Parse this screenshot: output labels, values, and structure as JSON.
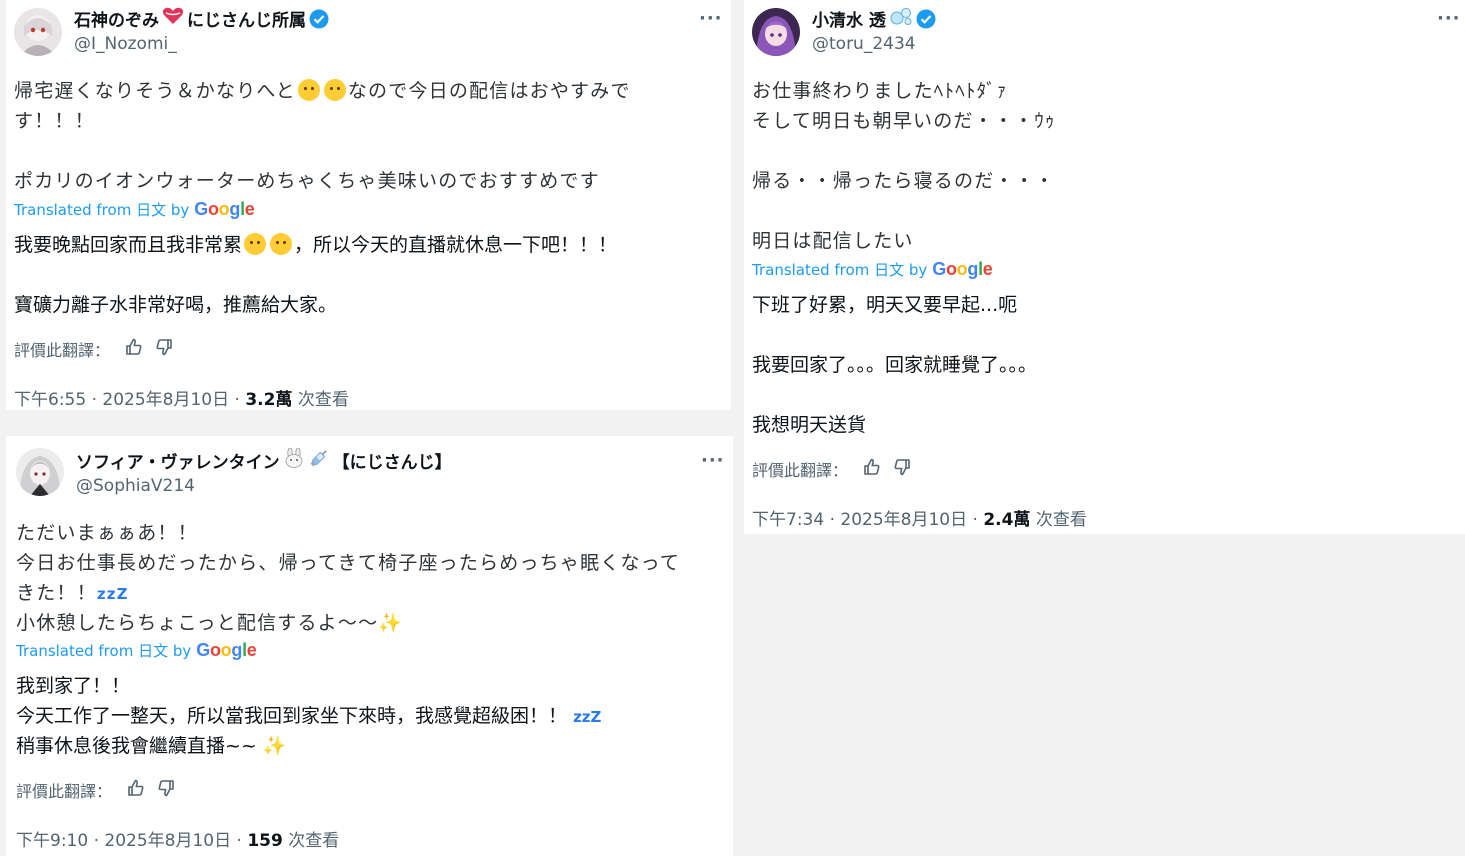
{
  "posts": [
    {
      "id": "nozomi",
      "display_name": "石神のぞみ",
      "display_name_suffix": "にじさんじ所属",
      "handle": "@I_Nozomi_",
      "original_lines": [
        "帰宅遅くなりそう＆かなりへと",
        "なので今日の配信はおやすみで",
        "す！！！",
        "ポカリのイオンウォーターめちゃくちゃ美味いのでおすすめです"
      ],
      "translated_from": "Translated from 日文 by",
      "translated_lines": [
        "我要晚點回家而且我非常累",
        "，所以今天的直播就休息一下吧！！！",
        "寶礦力離子水非常好喝，推薦給大家。"
      ],
      "rate_label": "評價此翻譯：",
      "time": "下午6:55 · 2025年8月10日 · ",
      "views_count": "3.2萬",
      "views_label": " 次查看"
    },
    {
      "id": "toru",
      "display_name": "小清水 透",
      "handle": "@toru_2434",
      "original_lines": [
        "お仕事終わりましたﾍﾄﾍﾄﾀﾞｧ",
        "そして明日も朝早いのだ・・・ｳｩ",
        "帰る・・帰ったら寝るのだ・・・",
        "明日は配信したい"
      ],
      "translated_from": "Translated from 日文 by",
      "translated_lines": [
        "下班了好累，明天又要早起...呃",
        "我要回家了。。。回家就睡覺了。。。",
        "我想明天送貨"
      ],
      "rate_label": "評價此翻譯：",
      "time": "下午7:34 · 2025年8月10日 · ",
      "views_count": "2.4萬",
      "views_label": " 次查看"
    },
    {
      "id": "sophia",
      "display_name": "ソフィア・ヴァレンタイン",
      "display_name_suffix": "【にじさんじ】",
      "handle": "@SophiaV214",
      "original_lines": [
        "ただいまぁぁあ！！",
        "今日お仕事長めだったから、帰ってきて椅子座ったらめっちゃ眠くなって",
        "きた！！",
        "小休憩したらちょこっと配信するよ〜〜"
      ],
      "translated_from": "Translated from 日文 by",
      "translated_lines": [
        "我到家了！！",
        "今天工作了一整天，所以當我回到家坐下來時，我感覺超級困！！",
        "稍事休息後我會繼續直播~~"
      ],
      "rate_label": "評價此翻譯：",
      "time": "下午9:10 · 2025年8月10日 · ",
      "views_count": "159",
      "views_label": " 次查看"
    }
  ],
  "google_logo": "Google",
  "zzz_glyph": "zzZ",
  "sparkle_glyph": "✨",
  "more_glyph": "···",
  "icons": {
    "verified": "verified-badge-icon",
    "thumbs_up": "thumbs-up-icon",
    "thumbs_down": "thumbs-down-icon",
    "heart": "heart-icon",
    "bubbles": "bubbles-icon",
    "rabbit": "rabbit-icon",
    "syringe": "syringe-icon"
  },
  "colors": {
    "link_blue": "#1d9bf0",
    "muted": "#536471",
    "google_blue": "#4285f4",
    "google_red": "#ea4335",
    "google_yellow": "#fbbc05",
    "google_green": "#34a853"
  }
}
